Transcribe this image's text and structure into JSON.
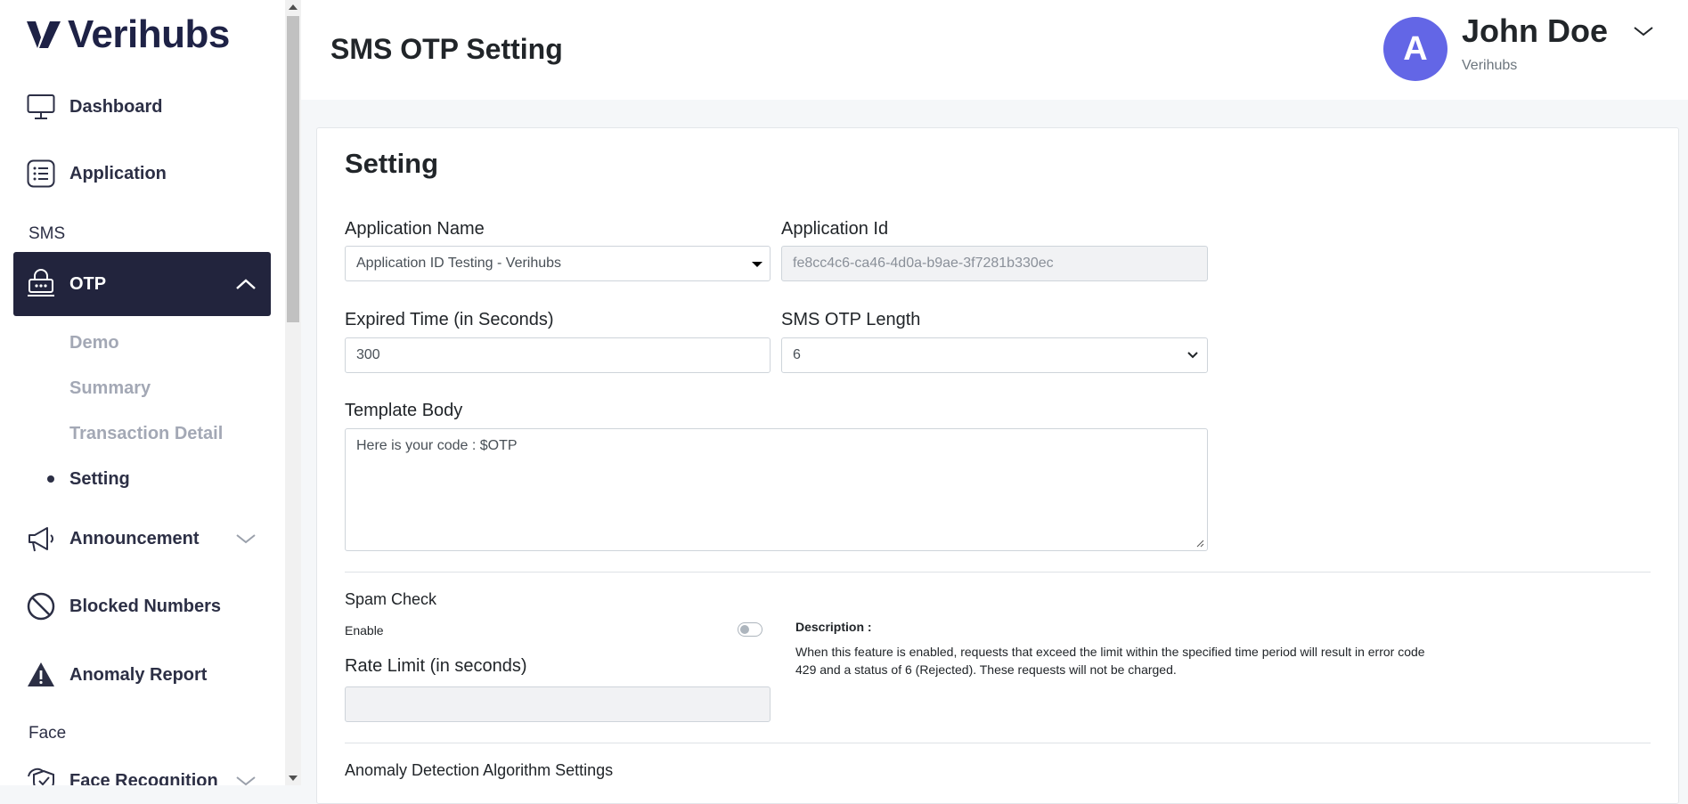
{
  "brand": {
    "name": "Verihubs"
  },
  "sidebar": {
    "items": [
      {
        "label": "Dashboard",
        "icon": "monitor-icon"
      },
      {
        "label": "Application",
        "icon": "list-icon"
      }
    ],
    "sections": {
      "sms": "SMS",
      "face": "Face"
    },
    "otp": {
      "label": "OTP",
      "icon": "robot-icon",
      "children": [
        "Demo",
        "Summary",
        "Transaction Detail",
        "Setting"
      ],
      "current": "Setting"
    },
    "more": [
      {
        "label": "Announcement",
        "icon": "megaphone-icon"
      },
      {
        "label": "Blocked Numbers",
        "icon": "blocked-icon"
      },
      {
        "label": "Anomaly Report",
        "icon": "warning-icon"
      },
      {
        "label": "Face Recognition",
        "icon": "face-shield-icon"
      }
    ]
  },
  "header": {
    "title": "SMS OTP Setting",
    "user": {
      "initial": "A",
      "name": "John Doe",
      "org": "Verihubs"
    }
  },
  "form": {
    "title": "Setting",
    "application_name": {
      "label": "Application Name",
      "value": "Application ID Testing - Verihubs"
    },
    "application_id": {
      "label": "Application Id",
      "value": "fe8cc4c6-ca46-4d0a-b9ae-3f7281b330ec"
    },
    "expired_time": {
      "label": "Expired Time (in Seconds)",
      "value": "300"
    },
    "otp_length": {
      "label": "SMS OTP Length",
      "value": "6"
    },
    "template_body": {
      "label": "Template Body",
      "value": "Here is your code : $OTP"
    },
    "spam_check": {
      "title": "Spam Check",
      "enable_label": "Enable",
      "enabled": false,
      "rate_limit_label": "Rate Limit (in seconds)",
      "rate_limit_value": "",
      "description_title": "Description :",
      "description_text": "When this feature is enabled, requests that exceed the limit within the specified time period will result in error code 429 and a status of 6 (Rejected). These requests will not be charged."
    },
    "anomaly_title": "Anomaly Detection Algorithm Settings"
  },
  "colors": {
    "sidebar_active": "#22243d",
    "avatar": "#6366e6",
    "brand": "#1e2246"
  }
}
